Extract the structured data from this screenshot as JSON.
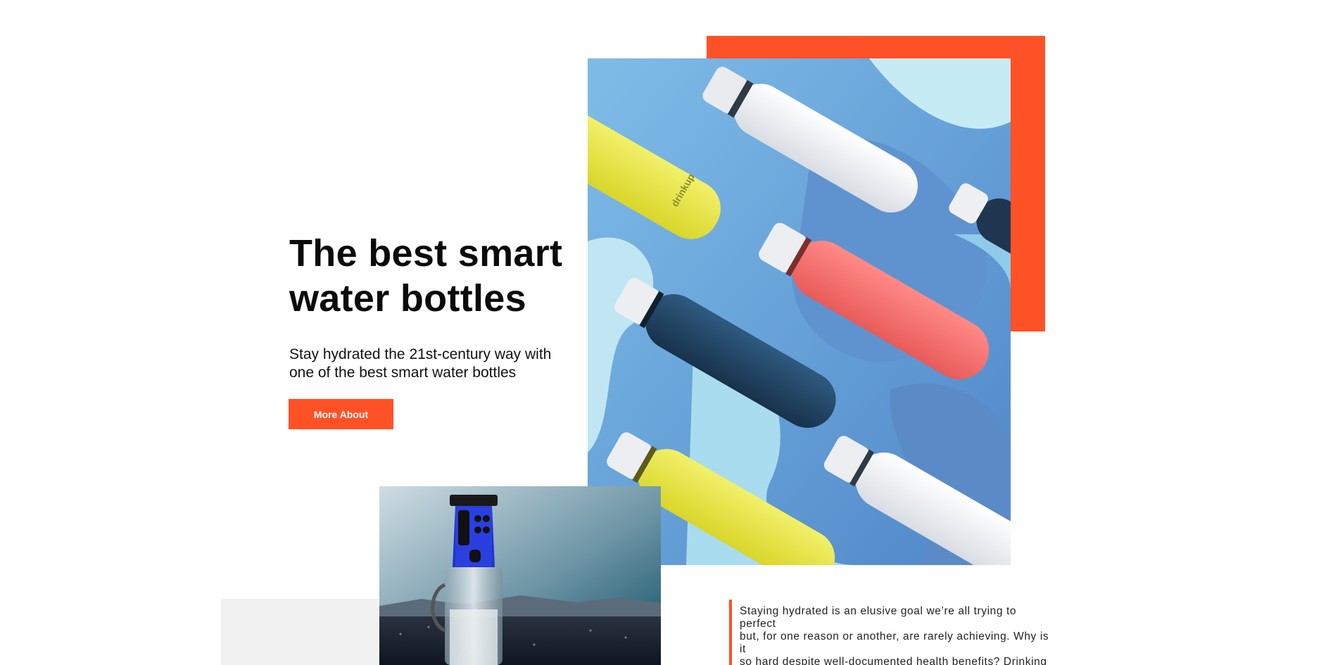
{
  "hero": {
    "title_line1": "The best smart",
    "title_line2": "water bottles",
    "subtitle_line1": "Stay hydrated the 21st-century way with",
    "subtitle_line2": "one of the best smart water bottles",
    "button_label": "More About"
  },
  "product_brand": "drinkup",
  "article": {
    "lines": [
      "Staying hydrated is an elusive goal we’re all trying to",
      "perfect",
      "but, for one reason or another, are rarely achieving. Why is",
      "it",
      "so hard despite well-documented health benefits? Drinking"
    ]
  },
  "colors": {
    "accent": "#FF5126",
    "panel_gray": "#f1f1f1",
    "text": "#111111"
  }
}
